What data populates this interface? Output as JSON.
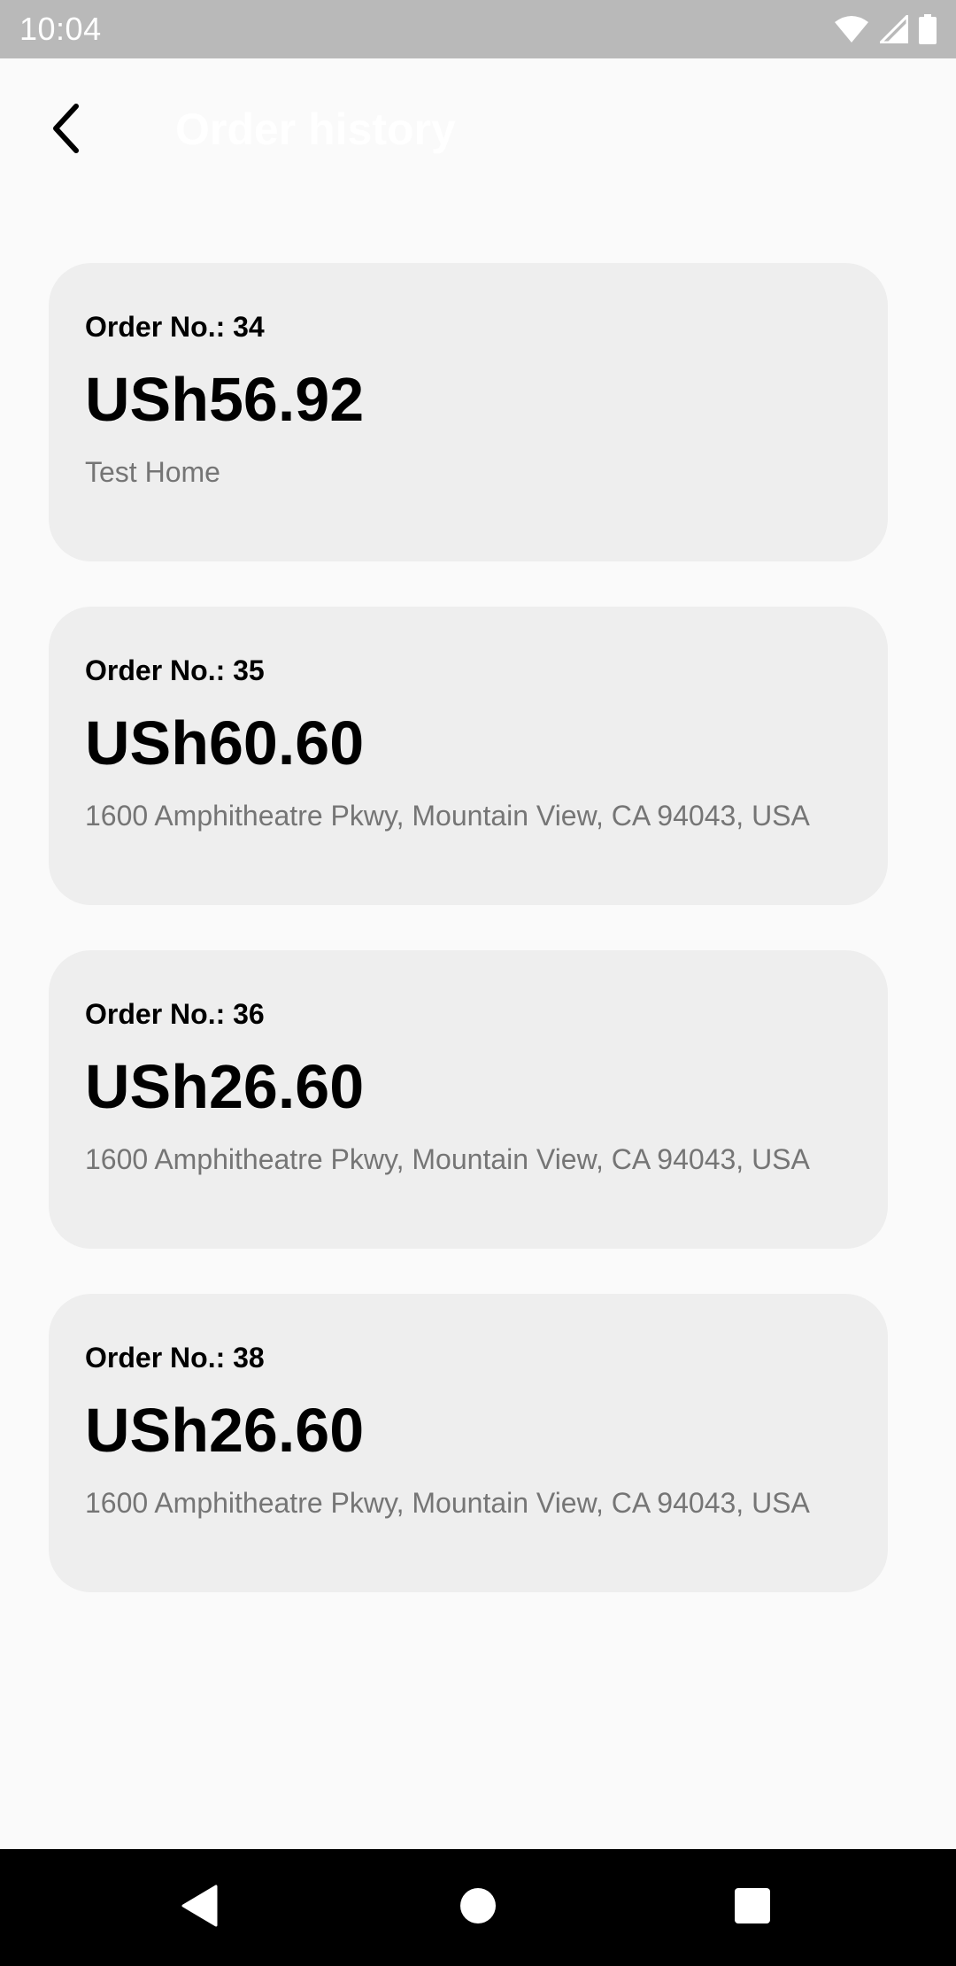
{
  "status_bar": {
    "time": "10:04",
    "icons": [
      "wifi-icon",
      "cellular-signal-icon",
      "battery-icon"
    ]
  },
  "header": {
    "back_icon": "arrow-back-icon",
    "title": "Order history"
  },
  "orders": [
    {
      "number_label": "Order No.: 34",
      "amount": "USh56.92",
      "address": "Test Home"
    },
    {
      "number_label": "Order No.: 35",
      "amount": "USh60.60",
      "address": "1600 Amphitheatre Pkwy, Mountain View, CA 94043, USA"
    },
    {
      "number_label": "Order No.: 36",
      "amount": "USh26.60",
      "address": "1600 Amphitheatre Pkwy, Mountain View, CA 94043, USA"
    },
    {
      "number_label": "Order No.: 38",
      "amount": "USh26.60",
      "address": "1600 Amphitheatre Pkwy, Mountain View, CA 94043, USA"
    }
  ],
  "nav_bar": {
    "icons": [
      "nav-back-icon",
      "nav-home-icon",
      "nav-recents-icon"
    ]
  },
  "colors": {
    "background": "#fafafa",
    "card": "#eeeeee",
    "status_bar": "#b9b9b9",
    "address_text": "#757575",
    "nav_bar": "#000000"
  }
}
